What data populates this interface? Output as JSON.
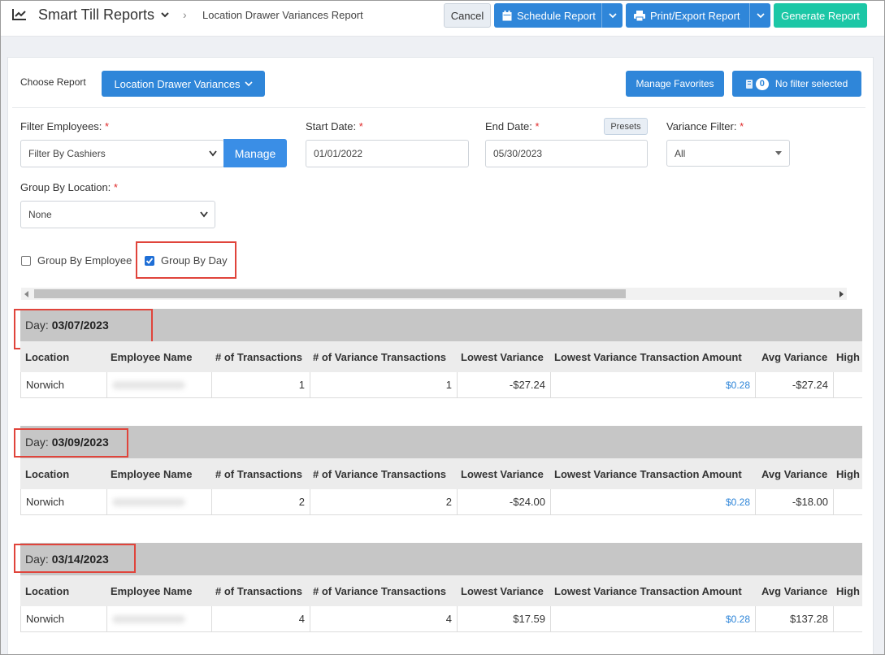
{
  "header": {
    "app_title": "Smart Till Reports",
    "breadcrumb": "Location Drawer Variances Report",
    "cancel_label": "Cancel",
    "schedule_label": "Schedule Report",
    "print_label": "Print/Export Report",
    "generate_label": "Generate Report"
  },
  "toolbar": {
    "choose_label": "Choose Report",
    "report_selected": "Location Drawer Variances",
    "favorites_label": "Manage Favorites",
    "filter_count": "0",
    "filter_label": "No filter selected"
  },
  "filters": {
    "employees_label": "Filter Employees:",
    "employees_value": "Filter By Cashiers",
    "manage_label": "Manage",
    "start_label": "Start Date:",
    "start_value": "01/01/2022",
    "end_label": "End Date:",
    "end_value": "05/30/2023",
    "presets_label": "Presets",
    "variance_label": "Variance Filter:",
    "variance_value": "All",
    "group_location_label": "Group By Location:",
    "group_location_value": "None",
    "required_mark": "*"
  },
  "options": {
    "group_by_employee": {
      "label": "Group By Employee",
      "checked": false
    },
    "group_by_day": {
      "label": "Group By Day",
      "checked": true
    }
  },
  "columns": [
    "Location",
    "Employee Name",
    "# of Transactions",
    "# of Variance Transactions",
    "Lowest Variance",
    "Lowest Variance Transaction Amount",
    "Avg Variance",
    "High"
  ],
  "day_prefix": "Day:",
  "days": [
    {
      "date": "03/07/2023",
      "rows": [
        {
          "location": "Norwich",
          "transactions": "1",
          "variance_transactions": "1",
          "lowest_variance": "-$27.24",
          "lowest_amount": "$0.28",
          "avg_variance": "-$27.24"
        }
      ]
    },
    {
      "date": "03/09/2023",
      "rows": [
        {
          "location": "Norwich",
          "transactions": "2",
          "variance_transactions": "2",
          "lowest_variance": "-$24.00",
          "lowest_amount": "$0.28",
          "avg_variance": "-$18.00"
        }
      ]
    },
    {
      "date": "03/14/2023",
      "rows": [
        {
          "location": "Norwich",
          "transactions": "4",
          "variance_transactions": "4",
          "lowest_variance": "$17.59",
          "lowest_amount": "$0.28",
          "avg_variance": "$137.28"
        }
      ]
    }
  ],
  "colors": {
    "primary": "#2f86d9",
    "accent": "#1cc7a6",
    "highlight": "#e0443b"
  }
}
